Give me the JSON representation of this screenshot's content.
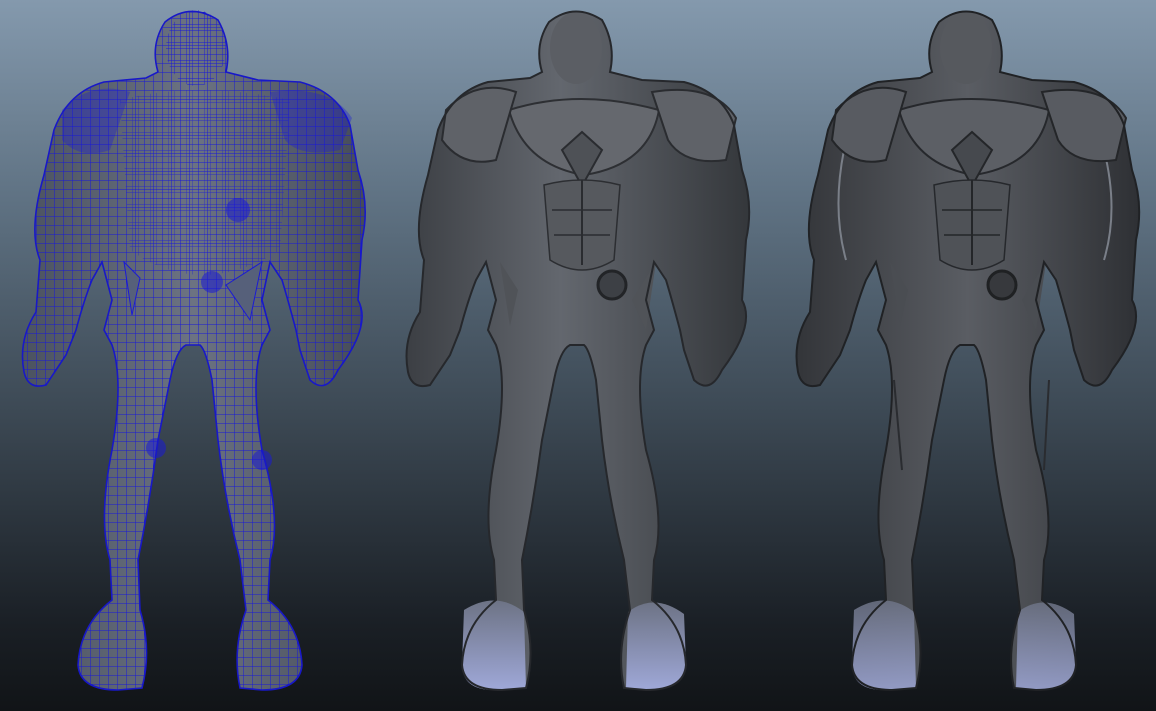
{
  "viewport": {
    "background_top": "#8499ad",
    "background_bottom": "#111417"
  },
  "models": [
    {
      "id": "wireframe",
      "display_mode": "shaded-wireframe",
      "shade_color": "#5c6470",
      "wire_color": "#1c1cd0"
    },
    {
      "id": "smooth",
      "display_mode": "smooth-shaded",
      "shade_color": "#55585e",
      "boot_color": "#8a93bd"
    },
    {
      "id": "textured",
      "display_mode": "smooth-shaded-detailed",
      "shade_color": "#4d5055",
      "boot_color": "#7e86ad"
    }
  ]
}
